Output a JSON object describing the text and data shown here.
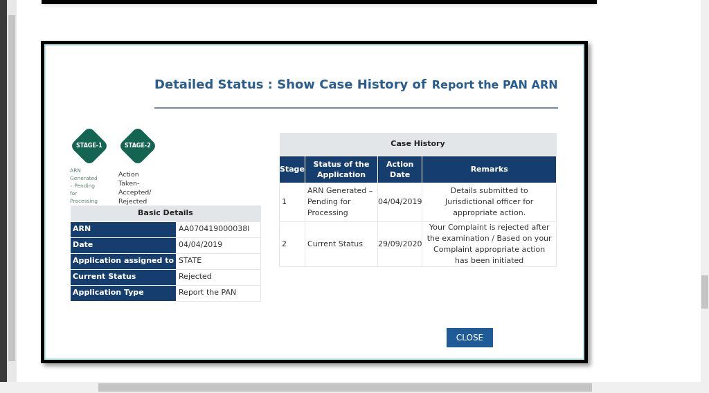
{
  "title": {
    "text": "Detailed Status : Show Case History of",
    "subject": "Report the PAN ARN"
  },
  "stages": [
    {
      "label": "STAGE-1",
      "caption": "ARN Generated – Pending for Processing",
      "current": false
    },
    {
      "label": "STAGE-2",
      "caption": "Action Taken- Accepted/ Rejected",
      "current": true
    }
  ],
  "basic_details": {
    "heading": "Basic Details",
    "rows": [
      {
        "label": "ARN",
        "value": "AA070419000038I"
      },
      {
        "label": "Date",
        "value": "04/04/2019"
      },
      {
        "label": "Application assigned to",
        "value": "STATE"
      },
      {
        "label": "Current Status",
        "value": "Rejected"
      },
      {
        "label": "Application Type",
        "value": "Report the PAN"
      }
    ]
  },
  "case_history": {
    "heading": "Case History",
    "columns": [
      "Stage",
      "Status of the Application",
      "Action Date",
      "Remarks"
    ],
    "rows": [
      [
        "1",
        "ARN Generated – Pending for Processing",
        "04/04/2019",
        "Details submitted to Jurisdictional officer for appropriate action."
      ],
      [
        "2",
        "Current Status",
        "29/09/2020",
        "Your Complaint is rejected after the examination / Based on your Complaint appropriate action has been initiated"
      ]
    ]
  },
  "close_button": "CLOSE"
}
